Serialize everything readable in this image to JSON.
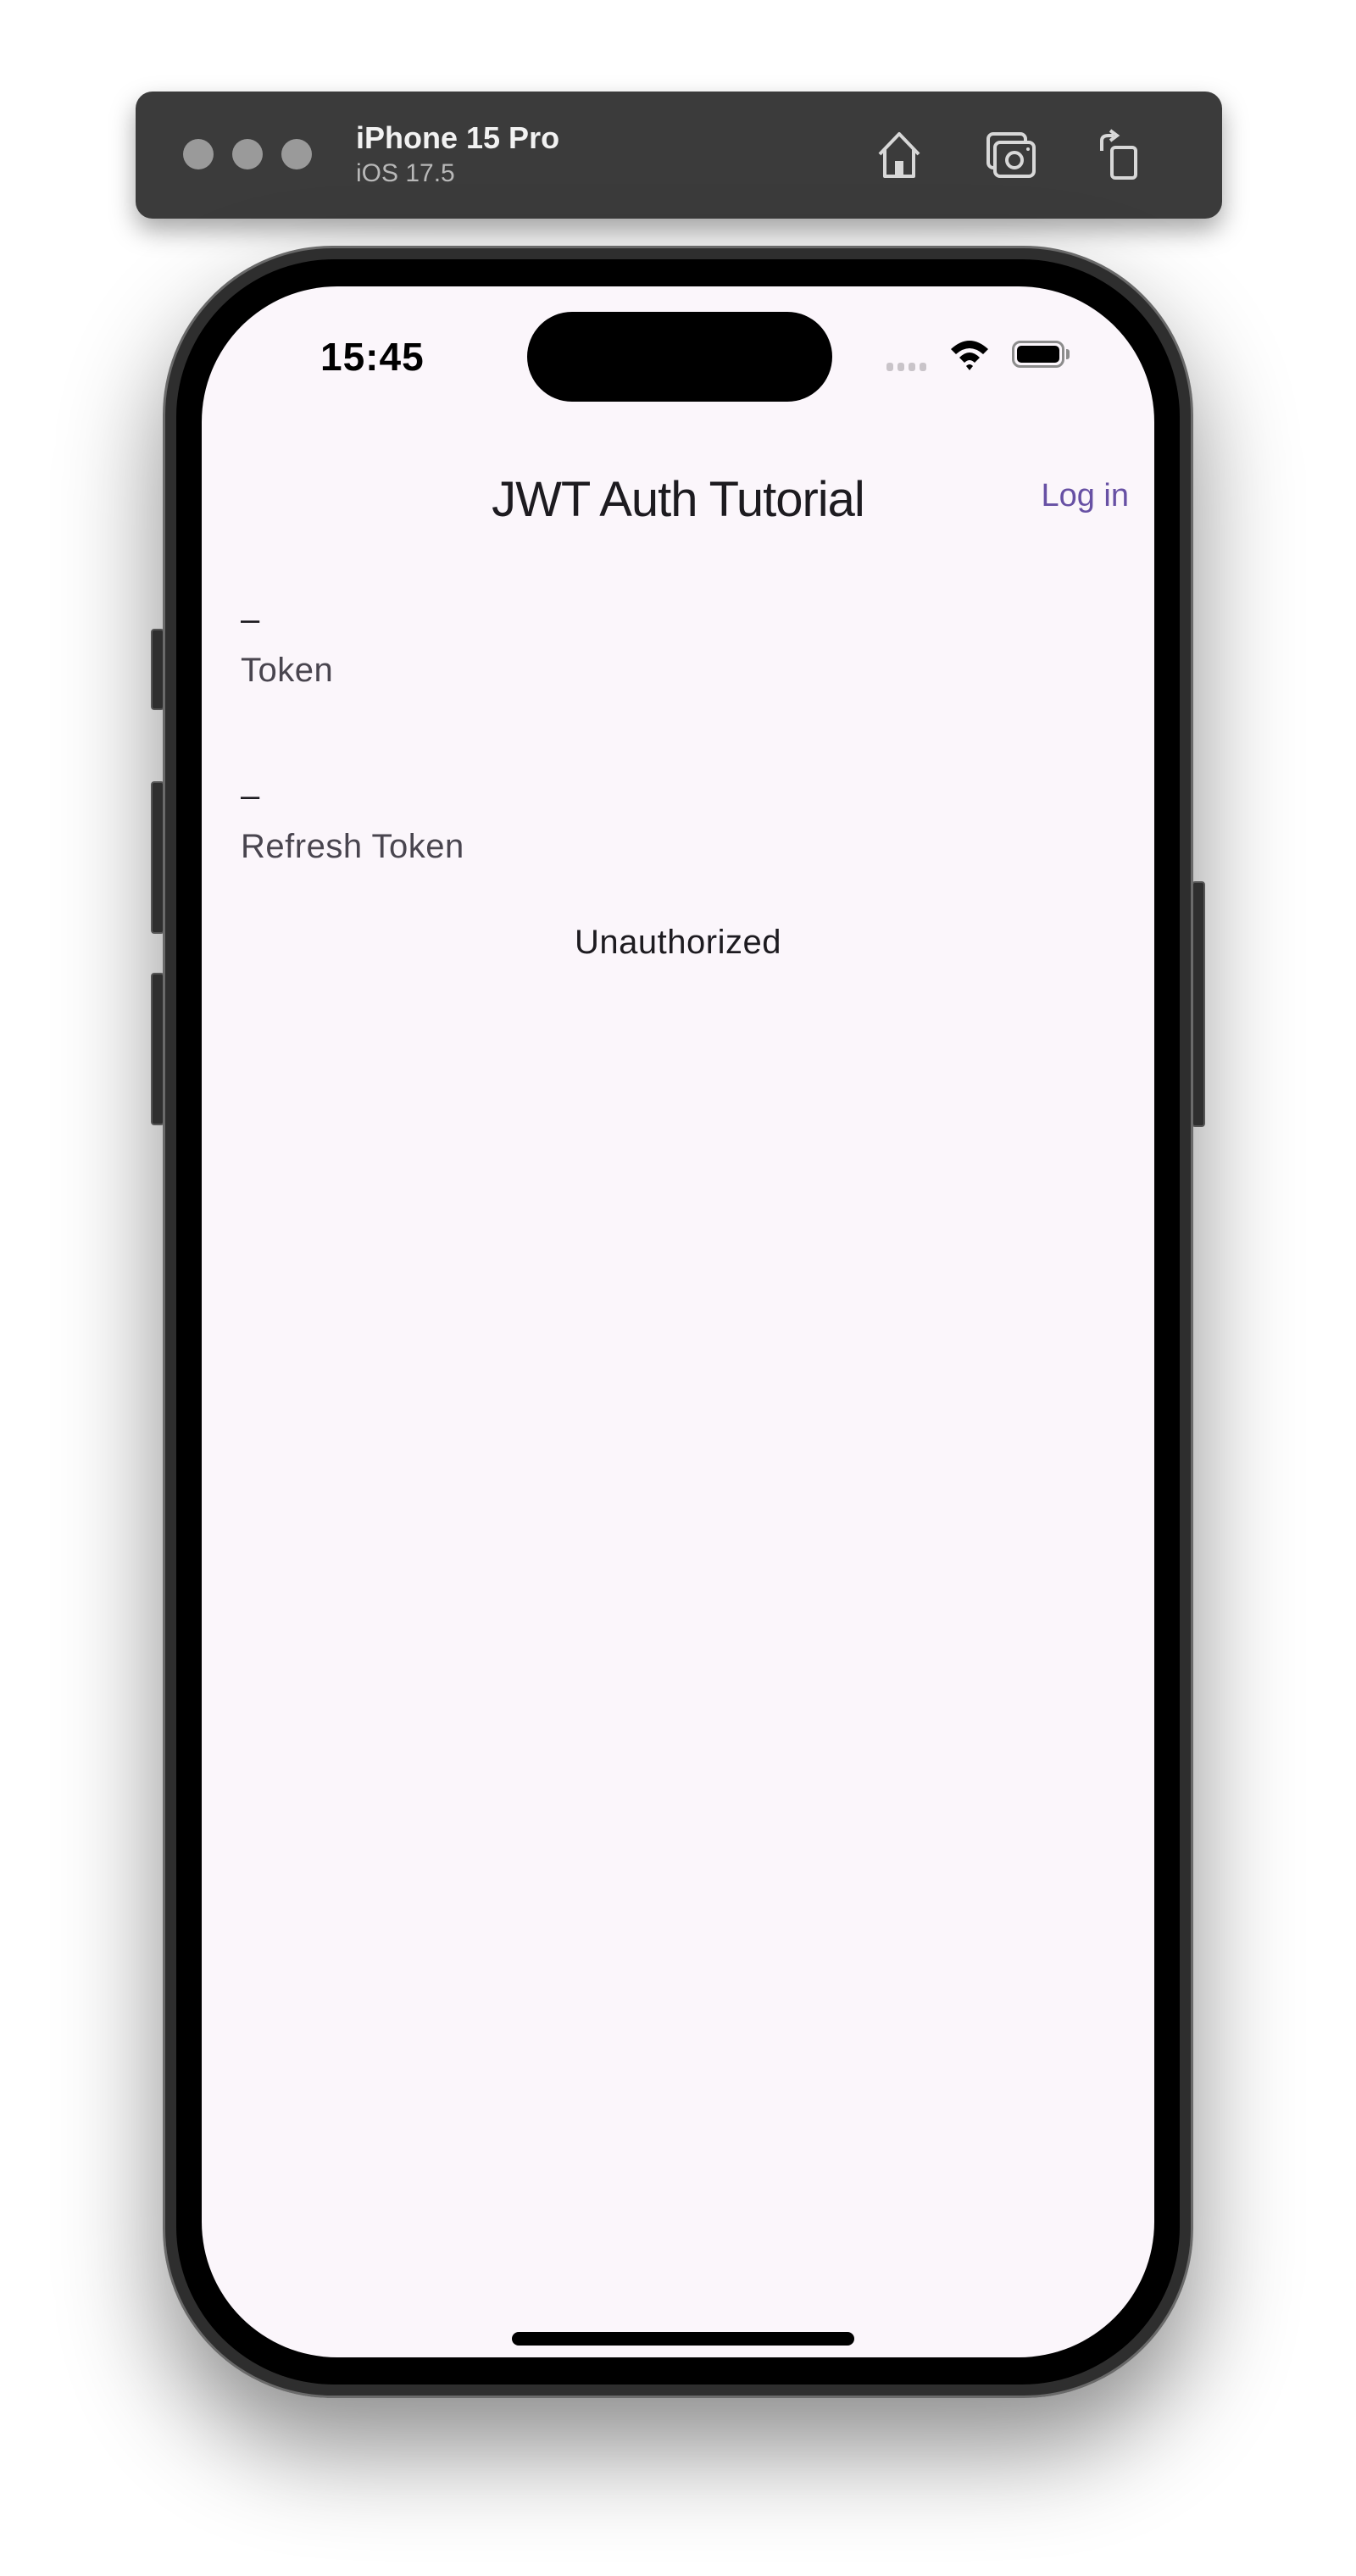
{
  "simulator": {
    "device_name": "iPhone 15 Pro",
    "os_version": "iOS 17.5",
    "toolbar_icons": [
      "home-icon",
      "screenshot-icon",
      "rotate-icon"
    ]
  },
  "status_bar": {
    "time": "15:45",
    "icons": [
      "cellular-signal-icon",
      "wifi-icon",
      "battery-icon"
    ]
  },
  "app": {
    "title": "JWT Auth Tutorial",
    "login_label": "Log in",
    "accent_color": "#6750A4",
    "background_color": "#FBF6FB"
  },
  "tokens": [
    {
      "value": "–",
      "label": "Token"
    },
    {
      "value": "–",
      "label": "Refresh Token"
    }
  ],
  "status_message": "Unauthorized"
}
